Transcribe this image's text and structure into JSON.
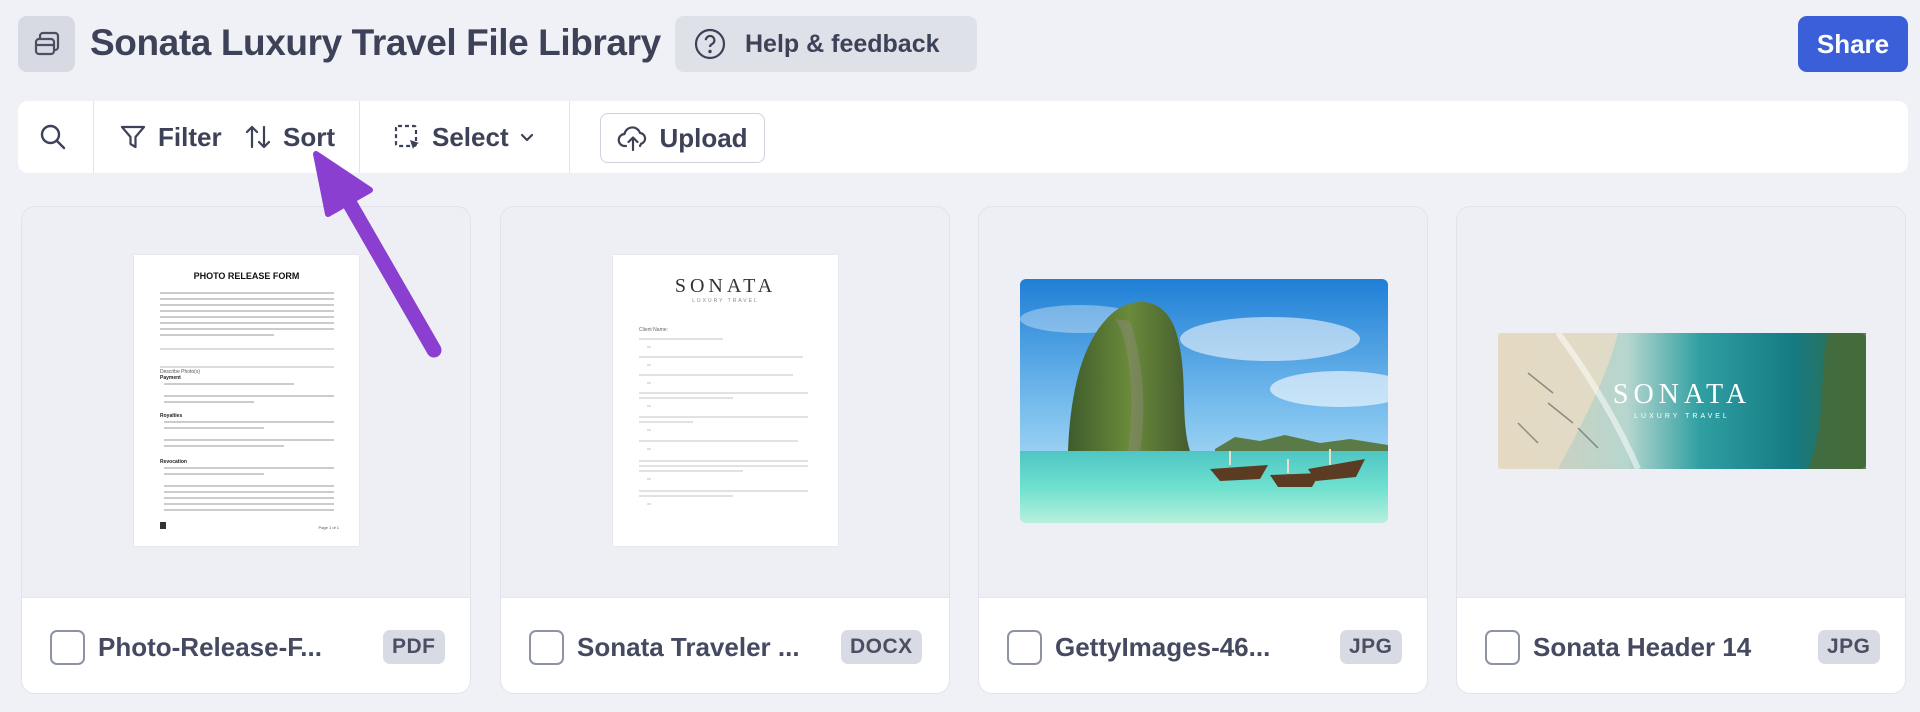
{
  "header": {
    "title": "Sonata Luxury Travel File Library",
    "library_icon": "library-stack-icon",
    "help_label": "Help & feedback",
    "help_icon": "question-circle-icon",
    "share_label": "Share"
  },
  "toolbar": {
    "search_icon": "search-icon",
    "filter_label": "Filter",
    "sort_label": "Sort",
    "select_label": "Select",
    "upload_label": "Upload"
  },
  "files": [
    {
      "name": "Photo-Release-F...",
      "type": "PDF"
    },
    {
      "name": "Sonata Traveler ...",
      "type": "DOCX"
    },
    {
      "name": "GettyImages-46...",
      "type": "JPG"
    },
    {
      "name": "Sonata Header 14",
      "type": "JPG"
    }
  ],
  "previews": {
    "photo_release": {
      "heading": "PHOTO RELEASE FORM",
      "section_photos": "Describe Photo(s)",
      "payment": "Payment",
      "royalties": "Royalties",
      "revocation": "Revocation",
      "footer": "Page 1 of 1"
    },
    "traveler_doc": {
      "logo": "SONATA",
      "tagline": "LUXURY TRAVEL",
      "client_name": "Client Name:"
    },
    "header_image": {
      "logo": "SONATA",
      "tagline": "LUXURY TRAVEL"
    }
  },
  "colors": {
    "accent": "#3a5fd8",
    "annotation_arrow": "#8a3fd0"
  }
}
